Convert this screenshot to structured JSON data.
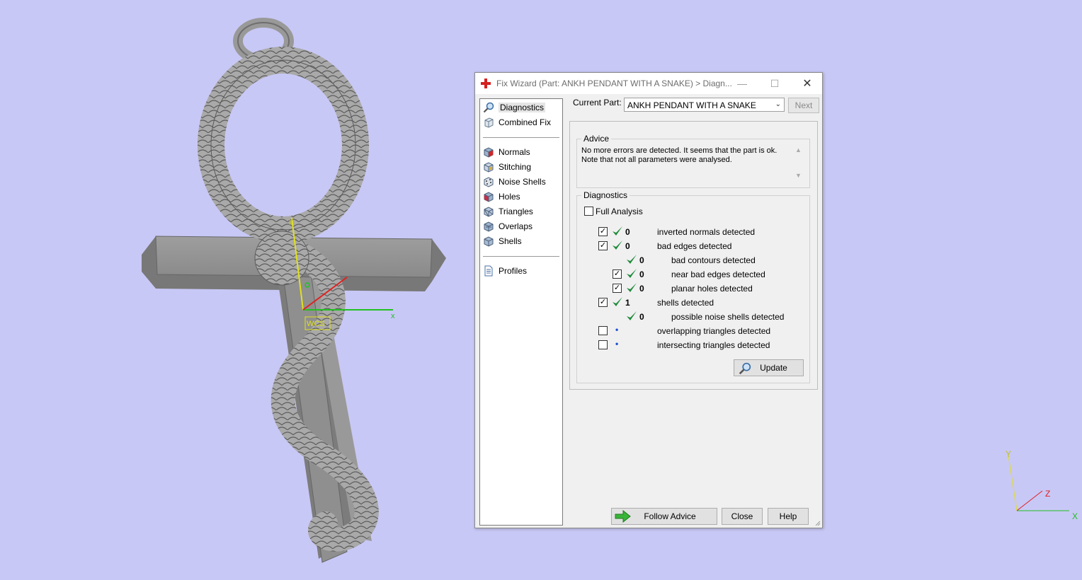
{
  "viewport": {
    "wcs_label": "WCS",
    "axis_x": "x",
    "axis_y": "y",
    "corner_axis_x": "X",
    "corner_axis_y": "Y",
    "corner_axis_z": "Z"
  },
  "dialog": {
    "title": "Fix Wizard (Part: ANKH PENDANT WITH A SNAKE) > Diagn...",
    "nav": {
      "items_top": [
        {
          "label": "Diagnostics",
          "icon": "magnifier-icon",
          "selected": true
        },
        {
          "label": "Combined Fix",
          "icon": "cube-icon"
        }
      ],
      "items_mid": [
        {
          "label": "Normals",
          "icon": "normals-cube-icon"
        },
        {
          "label": "Stitching",
          "icon": "stitching-cube-icon"
        },
        {
          "label": "Noise Shells",
          "icon": "noise-shells-cube-icon"
        },
        {
          "label": "Holes",
          "icon": "holes-cube-icon"
        },
        {
          "label": "Triangles",
          "icon": "triangles-cube-icon"
        },
        {
          "label": "Overlaps",
          "icon": "overlaps-cube-icon"
        },
        {
          "label": "Shells",
          "icon": "shells-cube-icon"
        }
      ],
      "items_bottom": [
        {
          "label": "Profiles",
          "icon": "document-icon"
        }
      ]
    },
    "current_part_label": "Current Part:",
    "current_part_value": "ANKH PENDANT WITH A SNAKE",
    "next_label": "Next",
    "advice": {
      "title": "Advice",
      "line1": "No more errors are detected. It seems that the part is ok.",
      "line2": "Note that not all parameters were analysed."
    },
    "diagnostics": {
      "title": "Diagnostics",
      "full_analysis_label": "Full Analysis",
      "full_analysis_checked": false,
      "rows": [
        {
          "checkbox": true,
          "checked": true,
          "status": "ok",
          "count": "0",
          "label": "inverted normals detected",
          "indent": 0
        },
        {
          "checkbox": true,
          "checked": true,
          "status": "ok",
          "count": "0",
          "label": "bad edges detected",
          "indent": 0
        },
        {
          "checkbox": false,
          "checked": false,
          "status": "ok",
          "count": "0",
          "label": "bad contours detected",
          "indent": 1
        },
        {
          "checkbox": true,
          "checked": true,
          "status": "ok",
          "count": "0",
          "label": "near bad edges detected",
          "indent": 1
        },
        {
          "checkbox": true,
          "checked": true,
          "status": "ok",
          "count": "0",
          "label": "planar holes detected",
          "indent": 1
        },
        {
          "checkbox": true,
          "checked": true,
          "status": "ok",
          "count": "1",
          "label": "shells detected",
          "indent": 0
        },
        {
          "checkbox": false,
          "checked": false,
          "status": "ok",
          "count": "0",
          "label": "possible noise shells detected",
          "indent": 1
        },
        {
          "checkbox": true,
          "checked": false,
          "status": "pending",
          "count": "",
          "label": "overlapping triangles detected",
          "indent": 0
        },
        {
          "checkbox": true,
          "checked": false,
          "status": "pending",
          "count": "",
          "label": "intersecting triangles detected",
          "indent": 0
        }
      ],
      "update_label": "Update"
    },
    "footer": {
      "follow_advice_label": "Follow Advice",
      "close_label": "Close",
      "help_label": "Help"
    }
  },
  "colors": {
    "background": "#c8c8f6",
    "check_green": "#1e8a3a",
    "title_icon_red": "#d42020",
    "bullet_blue": "#1a4fd0"
  }
}
